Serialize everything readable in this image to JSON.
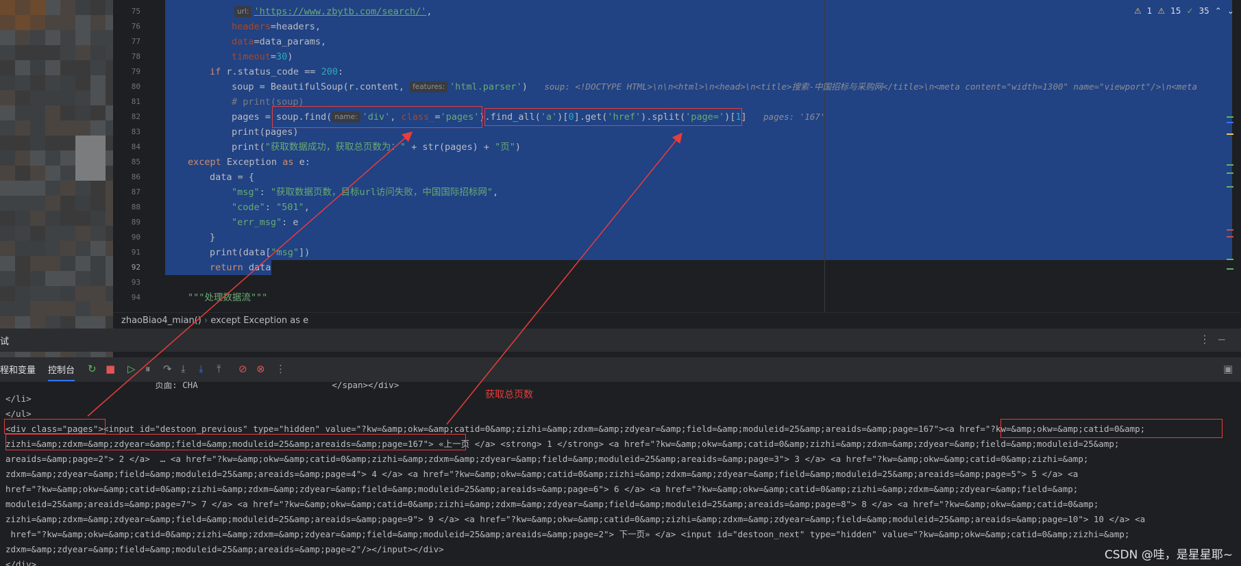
{
  "editor": {
    "line_numbers": [
      "75",
      "76",
      "77",
      "78",
      "79",
      "80",
      "81",
      "82",
      "83",
      "84",
      "85",
      "86",
      "87",
      "88",
      "89",
      "90",
      "91",
      "92",
      "93",
      "94"
    ],
    "current_line": "92",
    "lines": {
      "l75_hint": "url:",
      "l75_str": "'https://www.zbytb.com/search/'",
      "l75_tail": ",",
      "l76_param": "headers",
      "l76_tail": "=headers,",
      "l77_param": "data",
      "l77_tail": "=data_params,",
      "l78_param": "timeout",
      "l78_eq": "=",
      "l78_num": "30",
      "l78_tail": ")",
      "l79_kw": "if",
      "l79_mid": " r.status_code == ",
      "l79_num": "200",
      "l79_tail": ":",
      "l80_head": "soup = BeautifulSoup(r.content, ",
      "l80_hint": "features:",
      "l80_str": "'html.parser'",
      "l80_tail": ")",
      "l80_inline": "soup: <!DOCTYPE HTML>\\n\\n<html>\\n<head>\\n<title>搜索-中国招标与采购网</title>\\n<meta content=\"width=1300\" name=\"viewport\"/>\\n<meta",
      "l81_comment": "# print(soup)",
      "l82_head": "pages = soup.find(",
      "l82_hint": "name:",
      "l82_str1": "'div'",
      "l82_comma": ", ",
      "l82_param": "class_",
      "l82_eq": "=",
      "l82_str2": "'pages'",
      "l82_mid": ").find_all(",
      "l82_str3": "'a'",
      "l82_mid2": ")[",
      "l82_num": "0",
      "l82_mid3": "].get(",
      "l82_str4": "'href'",
      "l82_mid4": ").split(",
      "l82_str5": "'page='",
      "l82_mid5": ")[",
      "l82_num2": "1",
      "l82_tail": "]",
      "l82_inline": "pages: '167'",
      "l83": "print(pages)",
      "l84_head": "print(",
      "l84_str": "\"获取数据成功，获取总页数为：\"",
      "l84_mid": " + str(pages) + ",
      "l84_str2": "\"页\"",
      "l84_tail": ")",
      "l85_kw": "except",
      "l85_mid": " Exception ",
      "l85_kw2": "as",
      "l85_tail": " e:",
      "l86": "data = {",
      "l87_key": "\"msg\"",
      "l87_colon": ": ",
      "l87_val": "\"获取数据页数，目标url访问失败，中国国际招标网\"",
      "l87_tail": ",",
      "l88_key": "\"code\"",
      "l88_colon": ": ",
      "l88_val": "\"501\"",
      "l88_tail": ",",
      "l89_key": "\"err_msg\"",
      "l89_tail": ": e",
      "l90": "}",
      "l91_head": "print(data[",
      "l91_str": "\"msg\"",
      "l91_tail": "])",
      "l92_kw": "return",
      "l92_tail": " data",
      "l94_doc": "\"\"\"处理数据流\"\"\""
    },
    "problems": {
      "warnings": "1",
      "weak": "15",
      "typos": "35"
    }
  },
  "breadcrumb": {
    "function": "zhaoBiao4_mian()",
    "block": "except Exception as e"
  },
  "tool_window": {
    "title_fragment": "试",
    "tab_vars": "程和变量",
    "tab_console": "控制台"
  },
  "console": {
    "l0": "    页面: CHA                          </span></div>",
    "l1": "</li>",
    "l2": "</ul>",
    "l3": "<div class=\"pages\"><input id=\"destoon_previous\" type=\"hidden\" value=\"?kw=&amp;okw=&amp;catid=0&amp;zizhi=&amp;zdxm=&amp;zdyear=&amp;field=&amp;moduleid=25&amp;areaids=&amp;page=167\"><a href=\"?kw=&amp;okw=&amp;catid=0&amp;",
    "l4": "zizhi=&amp;zdxm=&amp;zdyear=&amp;field=&amp;moduleid=25&amp;areaids=&amp;page=167\"> «上一页 </a> <strong> 1 </strong> <a href=\"?kw=&amp;okw=&amp;catid=0&amp;zizhi=&amp;zdxm=&amp;zdyear=&amp;field=&amp;moduleid=25&amp;",
    "l5": "areaids=&amp;page=2\"> 2 </a>  … <a href=\"?kw=&amp;okw=&amp;catid=0&amp;zizhi=&amp;zdxm=&amp;zdyear=&amp;field=&amp;moduleid=25&amp;areaids=&amp;page=3\"> 3 </a> <a href=\"?kw=&amp;okw=&amp;catid=0&amp;zizhi=&amp;",
    "l6": "zdxm=&amp;zdyear=&amp;field=&amp;moduleid=25&amp;areaids=&amp;page=4\"> 4 </a> <a href=\"?kw=&amp;okw=&amp;catid=0&amp;zizhi=&amp;zdxm=&amp;zdyear=&amp;field=&amp;moduleid=25&amp;areaids=&amp;page=5\"> 5 </a> <a",
    "l7": "href=\"?kw=&amp;okw=&amp;catid=0&amp;zizhi=&amp;zdxm=&amp;zdyear=&amp;field=&amp;moduleid=25&amp;areaids=&amp;page=6\"> 6 </a> <a href=\"?kw=&amp;okw=&amp;catid=0&amp;zizhi=&amp;zdxm=&amp;zdyear=&amp;field=&amp;",
    "l8": "moduleid=25&amp;areaids=&amp;page=7\"> 7 </a> <a href=\"?kw=&amp;okw=&amp;catid=0&amp;zizhi=&amp;zdxm=&amp;zdyear=&amp;field=&amp;moduleid=25&amp;areaids=&amp;page=8\"> 8 </a> <a href=\"?kw=&amp;okw=&amp;catid=0&amp;",
    "l9": "zizhi=&amp;zdxm=&amp;zdyear=&amp;field=&amp;moduleid=25&amp;areaids=&amp;page=9\"> 9 </a> <a href=\"?kw=&amp;okw=&amp;catid=0&amp;zizhi=&amp;zdxm=&amp;zdyear=&amp;field=&amp;moduleid=25&amp;areaids=&amp;page=10\"> 10 </a> <a",
    "l10": " href=\"?kw=&amp;okw=&amp;catid=0&amp;zizhi=&amp;zdxm=&amp;zdyear=&amp;field=&amp;moduleid=25&amp;areaids=&amp;page=2\"> 下一页» </a> <input id=\"destoon_next\" type=\"hidden\" value=\"?kw=&amp;okw=&amp;catid=0&amp;zizhi=&amp;",
    "l11": "zdxm=&amp;zdyear=&amp;field=&amp;moduleid=25&amp;areaids=&amp;page=2\"/></input></div>",
    "l12": "</div>"
  },
  "annotation": {
    "label": "获取总页数",
    "color": "#e83d3d"
  },
  "watermark": "CSDN @哇，是星星耶~",
  "colors": {
    "selection": "#214283",
    "background": "#1e1f22",
    "panel": "#2b2d30",
    "accent": "#3574f0"
  }
}
